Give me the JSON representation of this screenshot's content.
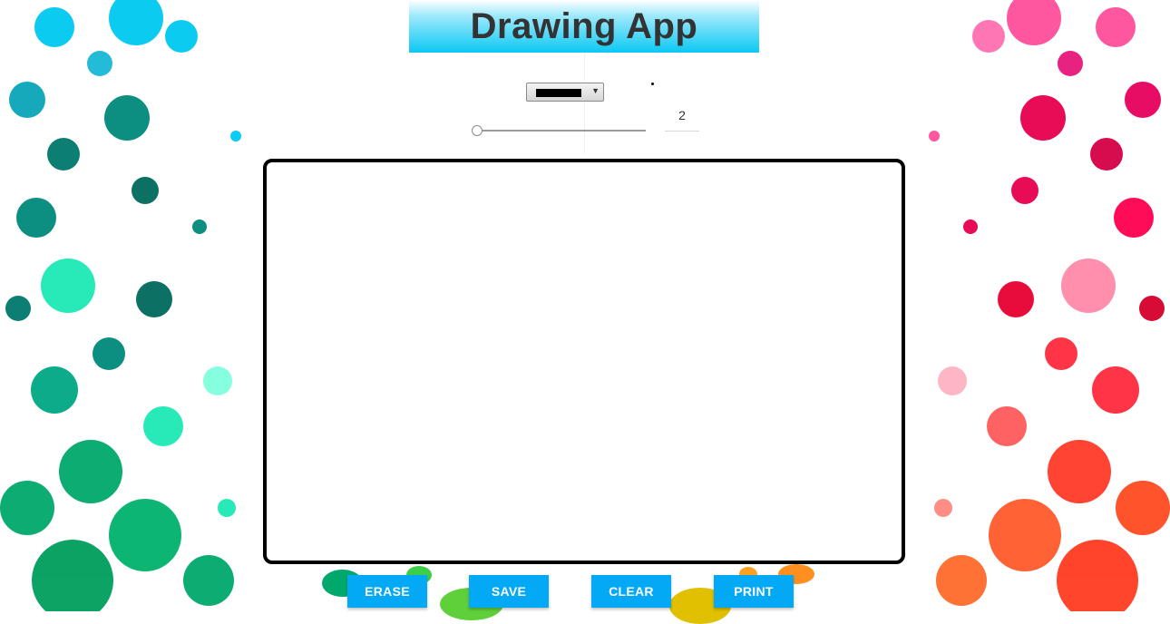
{
  "app": {
    "title": "Drawing App"
  },
  "toolbar": {
    "color_value": "#000000",
    "brush_size": "2",
    "brush_fraction": 0
  },
  "buttons": {
    "erase": "ERASE",
    "save": "SAVE",
    "clear": "CLEAR",
    "print": "PRINT"
  },
  "theme": {
    "accent": "#03a9f4",
    "header_gradient_end": "#0bc8f3",
    "splash_left": [
      "#00c9f0",
      "#00897b",
      "#1de9b6",
      "#00a86b"
    ],
    "splash_right": [
      "#ff4f9a",
      "#e6004c",
      "#ff2a3d",
      "#ff6a2a"
    ]
  }
}
